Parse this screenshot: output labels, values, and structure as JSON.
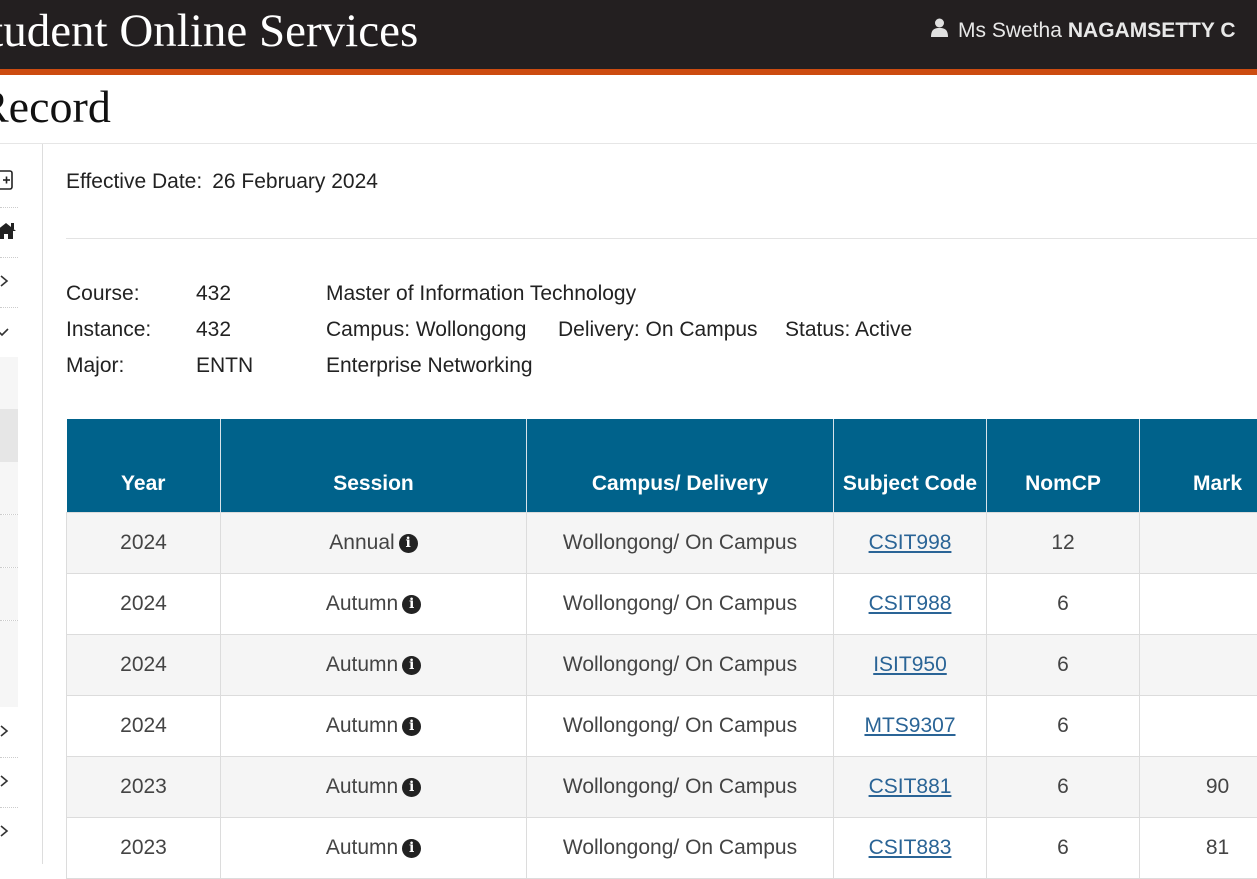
{
  "header": {
    "title": "Student Online Services",
    "user_salutation": "Ms Swetha",
    "user_surname": "NAGAMSETTY C"
  },
  "page": {
    "title": "Record"
  },
  "effective": {
    "label": "Effective Date:",
    "value": "26 February 2024"
  },
  "course": {
    "course_label": "Course:",
    "course_code": "432",
    "course_name": "Master of Information Technology",
    "instance_label": "Instance:",
    "instance_code": "432",
    "campus": "Campus: Wollongong",
    "delivery": "Delivery: On Campus",
    "status": "Status: Active",
    "major_label": "Major:",
    "major_code": "ENTN",
    "major_name": "Enterprise Networking"
  },
  "table": {
    "headers": [
      "Year",
      "Session",
      "Campus/ Delivery",
      "Subject Code",
      "NomCP",
      "Mark"
    ],
    "rows": [
      {
        "year": "2024",
        "session": "Annual",
        "campus": "Wollongong/ On Campus",
        "code": "CSIT998",
        "nomcp": "12",
        "mark": ""
      },
      {
        "year": "2024",
        "session": "Autumn",
        "campus": "Wollongong/ On Campus",
        "code": "CSIT988",
        "nomcp": "6",
        "mark": ""
      },
      {
        "year": "2024",
        "session": "Autumn",
        "campus": "Wollongong/ On Campus",
        "code": "ISIT950",
        "nomcp": "6",
        "mark": ""
      },
      {
        "year": "2024",
        "session": "Autumn",
        "campus": "Wollongong/ On Campus",
        "code": "MTS9307",
        "nomcp": "6",
        "mark": ""
      },
      {
        "year": "2023",
        "session": "Autumn",
        "campus": "Wollongong/ On Campus",
        "code": "CSIT881",
        "nomcp": "6",
        "mark": "90"
      },
      {
        "year": "2023",
        "session": "Autumn",
        "campus": "Wollongong/ On Campus",
        "code": "CSIT883",
        "nomcp": "6",
        "mark": "81"
      }
    ]
  },
  "colors": {
    "header_bg": "#231f20",
    "accent": "#cc4b10",
    "table_header": "#00628b",
    "link": "#2a6496"
  },
  "icons": [
    "user-icon",
    "expand-icon",
    "home-icon",
    "chevron-right-icon",
    "chevron-down-icon",
    "info-icon"
  ]
}
